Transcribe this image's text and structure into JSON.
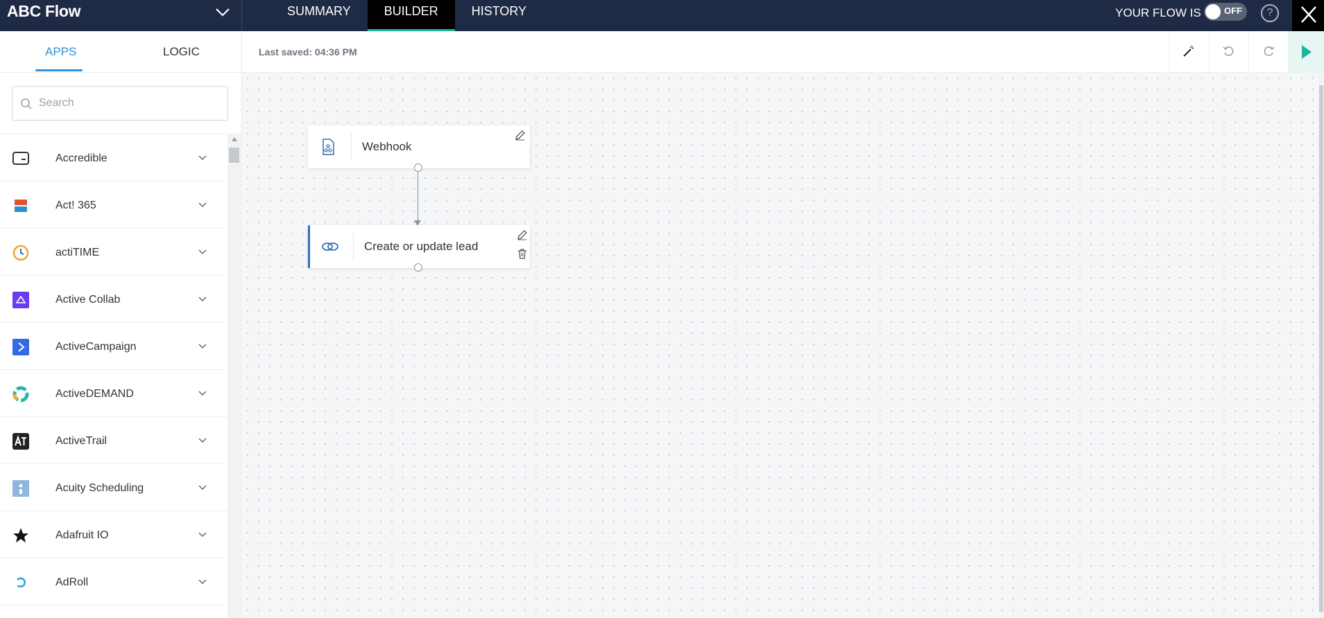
{
  "app": {
    "title": "ABC Flow",
    "tabs": [
      {
        "label": "SUMMARY",
        "active": false
      },
      {
        "label": "BUILDER",
        "active": true
      },
      {
        "label": "HISTORY",
        "active": false
      }
    ],
    "flow_status_label": "YOUR FLOW IS",
    "toggle_text": "OFF",
    "help_label": "?"
  },
  "sidebar": {
    "tabs": [
      {
        "label": "APPS",
        "active": true
      },
      {
        "label": "LOGIC",
        "active": false
      }
    ],
    "search": {
      "placeholder": "Search",
      "value": ""
    },
    "apps": [
      {
        "label": "Accredible",
        "icon": "accredible-icon"
      },
      {
        "label": "Act! 365",
        "icon": "act365-icon"
      },
      {
        "label": "actiTIME",
        "icon": "actitime-icon"
      },
      {
        "label": "Active Collab",
        "icon": "active-collab-icon"
      },
      {
        "label": "ActiveCampaign",
        "icon": "activecampaign-icon"
      },
      {
        "label": "ActiveDEMAND",
        "icon": "activedemand-icon"
      },
      {
        "label": "ActiveTrail",
        "icon": "activetrail-icon"
      },
      {
        "label": "Acuity Scheduling",
        "icon": "acuity-scheduling-icon"
      },
      {
        "label": "Adafruit IO",
        "icon": "adafruit-io-icon"
      },
      {
        "label": "AdRoll",
        "icon": "adroll-icon"
      }
    ]
  },
  "toolbar": {
    "last_saved": "Last saved: 04:36 PM"
  },
  "canvas": {
    "nodes": [
      {
        "label": "Webhook",
        "icon": "webhook-icon"
      },
      {
        "label": "Create or update lead",
        "icon": "link-icon",
        "selected": true
      }
    ]
  },
  "colors": {
    "topbar": "#1f2a44",
    "accent_teal": "#1fb59d",
    "accent_blue": "#2f8fd8"
  }
}
